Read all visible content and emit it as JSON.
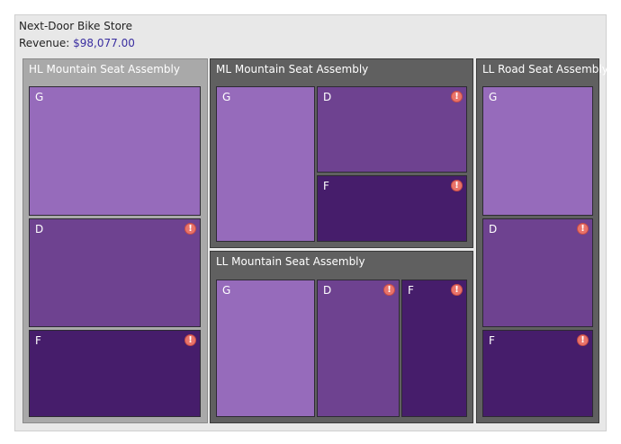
{
  "header": {
    "store_name": "Next-Door Bike Store",
    "revenue_label": "Revenue: ",
    "revenue_value": "$98,077.00"
  },
  "colors": {
    "tile_g": "#966bbb",
    "tile_d": "#6e4290",
    "tile_f": "#461d6b",
    "group_selected": "#a9a9a9",
    "group_normal": "#606060",
    "warning": "#e9736a"
  },
  "groups": [
    {
      "title": "HL Mountain Seat Assembly",
      "tiles": [
        {
          "label": "G",
          "warning": false
        },
        {
          "label": "D",
          "warning": true,
          "warning_glyph": "!"
        },
        {
          "label": "F",
          "warning": true,
          "warning_glyph": "!"
        }
      ]
    },
    {
      "title": "ML Mountain Seat Assembly",
      "tiles": [
        {
          "label": "G",
          "warning": false
        },
        {
          "label": "D",
          "warning": true,
          "warning_glyph": "!"
        },
        {
          "label": "F",
          "warning": true,
          "warning_glyph": "!"
        }
      ]
    },
    {
      "title": "LL Road Seat Assembly",
      "tiles": [
        {
          "label": "G",
          "warning": false
        },
        {
          "label": "D",
          "warning": true,
          "warning_glyph": "!"
        },
        {
          "label": "F",
          "warning": true,
          "warning_glyph": "!"
        }
      ]
    },
    {
      "title": "LL Mountain Seat Assembly",
      "tiles": [
        {
          "label": "G",
          "warning": false
        },
        {
          "label": "D",
          "warning": true,
          "warning_glyph": "!"
        },
        {
          "label": "F",
          "warning": true,
          "warning_glyph": "!"
        }
      ]
    }
  ],
  "icons": {
    "warning": "exclamation-circle-icon"
  }
}
